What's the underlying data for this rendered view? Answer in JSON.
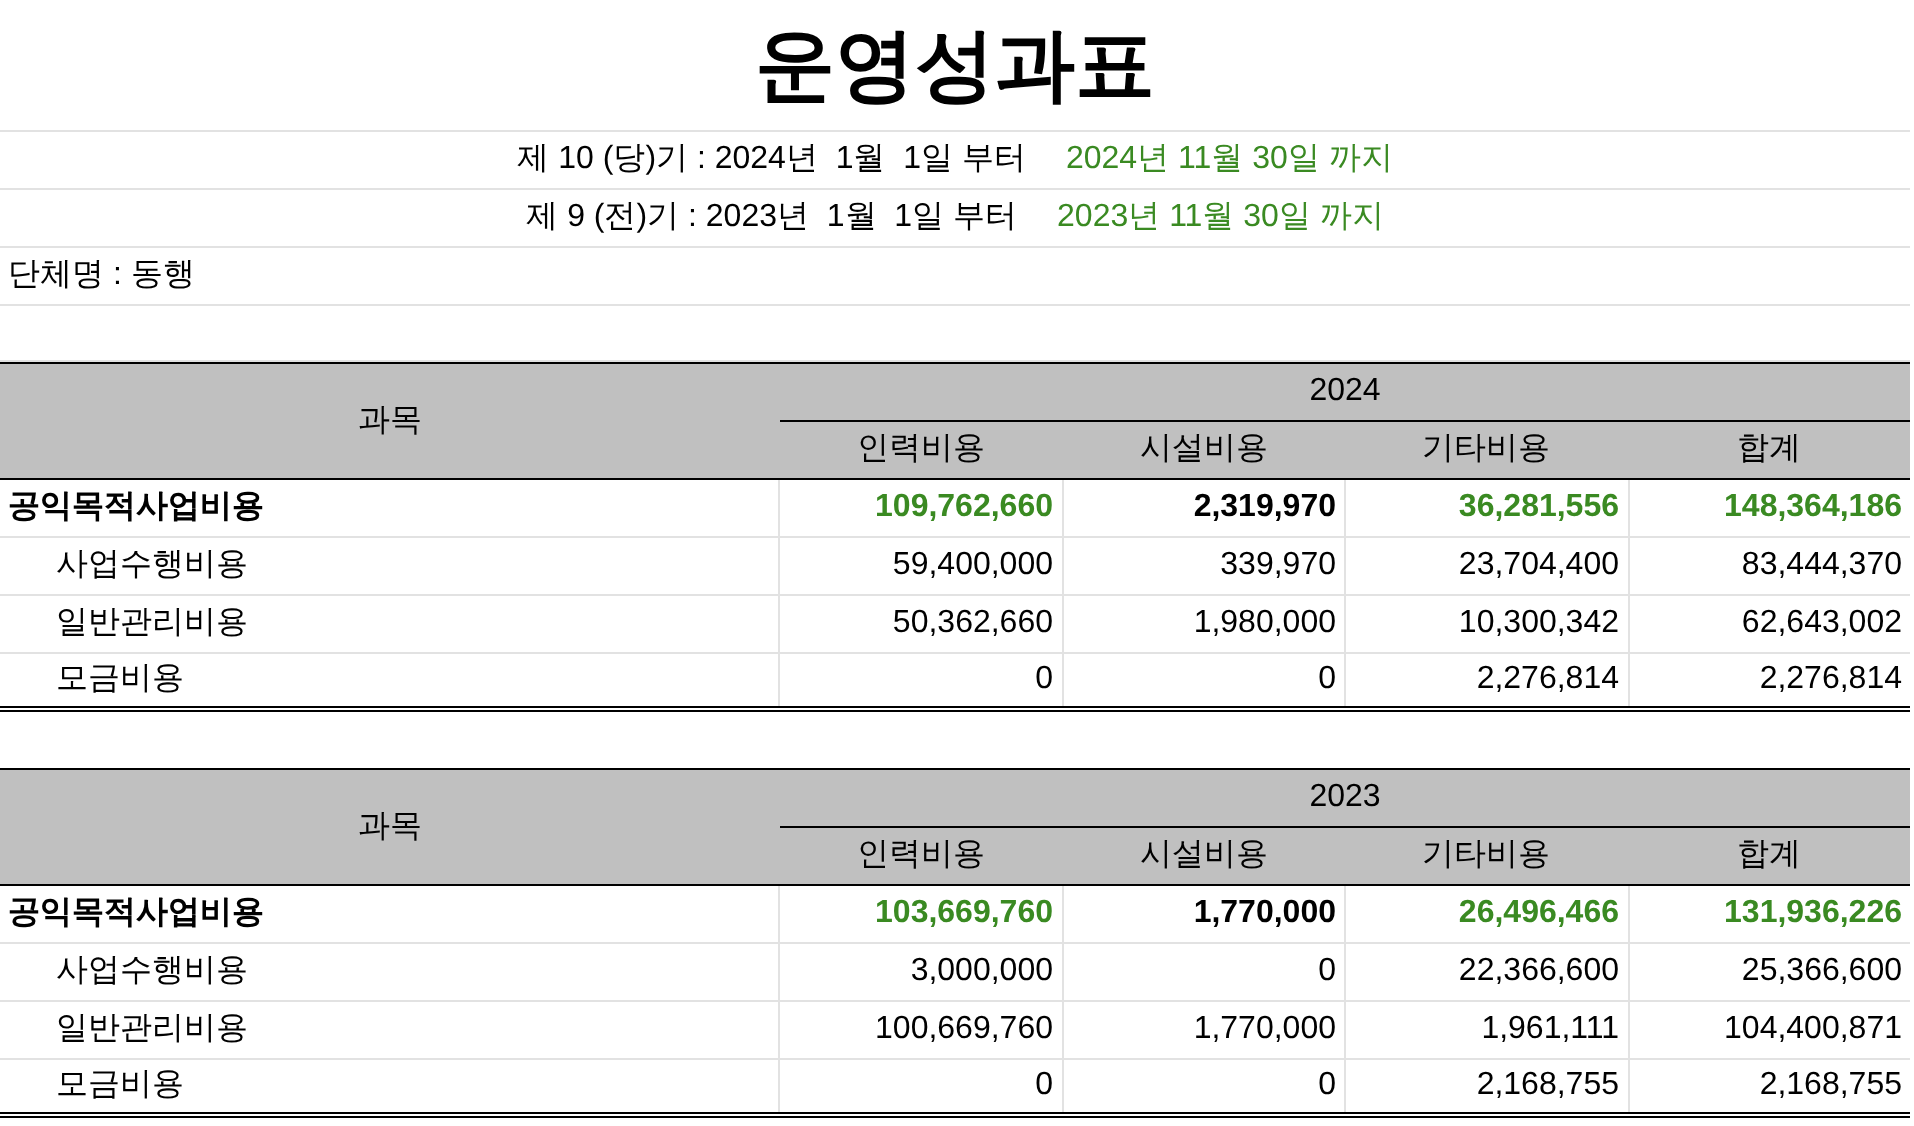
{
  "title": "운영성과표",
  "periods": [
    {
      "start": "제 10 (당)기 : 2024년  1월  1일 부터",
      "end": "2024년 11월 30일 까지"
    },
    {
      "start": "제 9 (전)기 : 2023년  1월  1일 부터",
      "end": "2023년 11월 30일 까지"
    }
  ],
  "organization": "단체명 : 동행",
  "tables": [
    {
      "subject_header": "과목",
      "year": "2024",
      "columns": [
        "인력비용",
        "시설비용",
        "기타비용",
        "합계"
      ],
      "rows": [
        {
          "kind": "total",
          "label": "공익목적사업비용",
          "cells": [
            {
              "text": "109,762,660",
              "color": "#3a8a22"
            },
            {
              "text": "2,319,970",
              "color": "#000000"
            },
            {
              "text": "36,281,556",
              "color": "#3a8a22"
            },
            {
              "text": "148,364,186",
              "color": "#3a8a22"
            }
          ]
        },
        {
          "kind": "item",
          "label": "사업수행비용",
          "cells": [
            {
              "text": "59,400,000"
            },
            {
              "text": "339,970"
            },
            {
              "text": "23,704,400"
            },
            {
              "text": "83,444,370"
            }
          ]
        },
        {
          "kind": "item",
          "label": "일반관리비용",
          "cells": [
            {
              "text": "50,362,660"
            },
            {
              "text": "1,980,000"
            },
            {
              "text": "10,300,342"
            },
            {
              "text": "62,643,002"
            }
          ]
        },
        {
          "kind": "item",
          "label": "모금비용",
          "cells": [
            {
              "text": "0"
            },
            {
              "text": "0"
            },
            {
              "text": "2,276,814"
            },
            {
              "text": "2,276,814"
            }
          ]
        }
      ]
    },
    {
      "subject_header": "과목",
      "year": "2023",
      "columns": [
        "인력비용",
        "시설비용",
        "기타비용",
        "합계"
      ],
      "rows": [
        {
          "kind": "total",
          "label": "공익목적사업비용",
          "cells": [
            {
              "text": "103,669,760",
              "color": "#3a8a22"
            },
            {
              "text": "1,770,000",
              "color": "#000000"
            },
            {
              "text": "26,496,466",
              "color": "#3a8a22"
            },
            {
              "text": "131,936,226",
              "color": "#3a8a22"
            }
          ]
        },
        {
          "kind": "item",
          "label": "사업수행비용",
          "cells": [
            {
              "text": "3,000,000"
            },
            {
              "text": "0"
            },
            {
              "text": "22,366,600"
            },
            {
              "text": "25,366,600"
            }
          ]
        },
        {
          "kind": "item",
          "label": "일반관리비용",
          "cells": [
            {
              "text": "100,669,760"
            },
            {
              "text": "1,770,000"
            },
            {
              "text": "1,961,111"
            },
            {
              "text": "104,400,871"
            }
          ]
        },
        {
          "kind": "item",
          "label": "모금비용",
          "cells": [
            {
              "text": "0"
            },
            {
              "text": "0"
            },
            {
              "text": "2,168,755"
            },
            {
              "text": "2,168,755"
            }
          ]
        }
      ]
    }
  ]
}
